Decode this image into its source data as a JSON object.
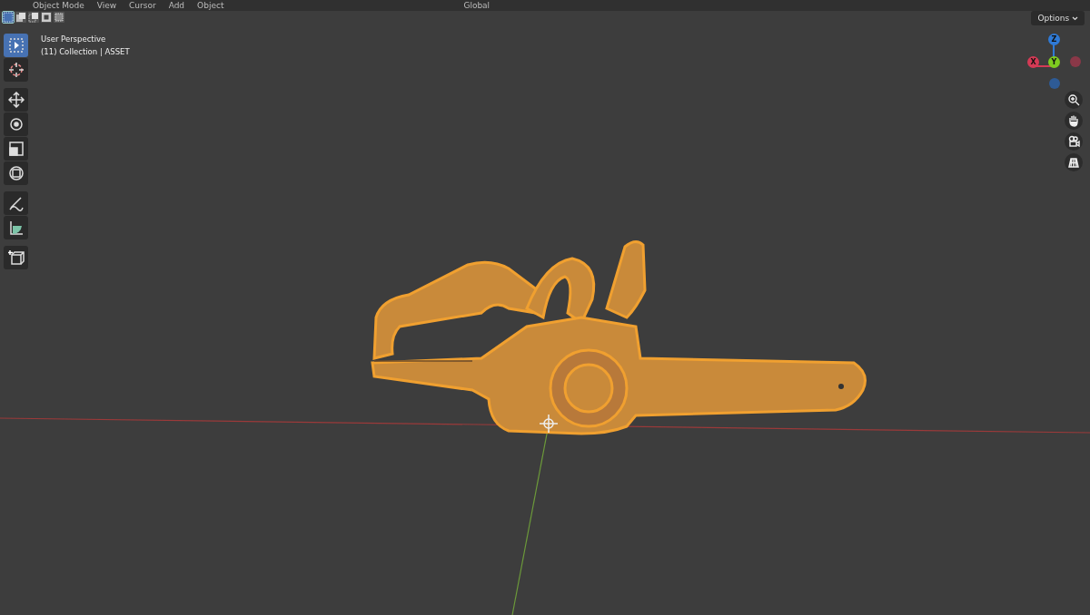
{
  "header": {
    "mode": "Object Mode",
    "menus": [
      "View",
      "Cursor",
      "Add",
      "Object"
    ],
    "orientation": "Global"
  },
  "select_modes": [
    {
      "kind": "new",
      "selected": true
    },
    {
      "kind": "extend",
      "selected": false
    },
    {
      "kind": "subtract",
      "selected": false
    },
    {
      "kind": "invert",
      "selected": false
    },
    {
      "kind": "intersect",
      "selected": false
    }
  ],
  "options_button": "Options",
  "viewport": {
    "view_name": "User Perspective",
    "collection": "(11) Collection | ASSET"
  },
  "tools": [
    {
      "kind": "select",
      "selected": true
    },
    {
      "kind": "cursor",
      "selected": false
    },
    {
      "kind": "move",
      "selected": false
    },
    {
      "kind": "rotate",
      "selected": false
    },
    {
      "kind": "scale",
      "selected": false
    },
    {
      "kind": "transform",
      "selected": false
    },
    {
      "kind": "annotate",
      "selected": false
    },
    {
      "kind": "measure",
      "selected": false
    },
    {
      "kind": "add-cube",
      "selected": false
    }
  ],
  "gizmo": {
    "axes": [
      {
        "label": "Z",
        "color": "#2f7ad6"
      },
      {
        "label": "X",
        "color": "#d43a55"
      },
      {
        "label": "Y",
        "color": "#7ecb20"
      }
    ]
  },
  "nav_buttons": [
    {
      "kind": "zoom"
    },
    {
      "kind": "pan"
    },
    {
      "kind": "camera"
    },
    {
      "kind": "grid"
    }
  ]
}
